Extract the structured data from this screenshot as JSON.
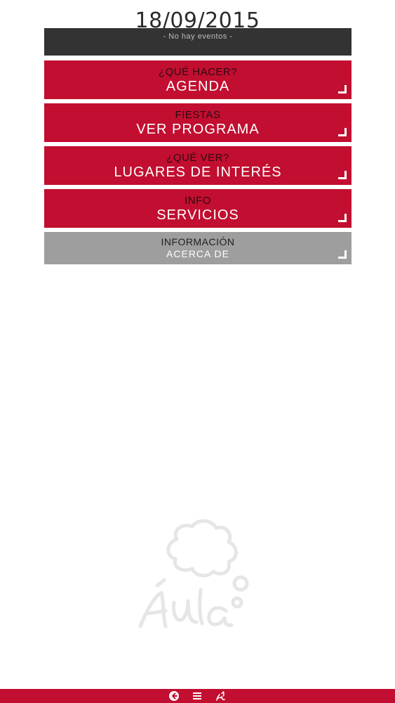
{
  "header": {
    "date": "18/09/2015"
  },
  "events": {
    "text": "- No hay eventos -"
  },
  "menu": [
    {
      "sub": "¿QUÉ HACER?",
      "main": "AGENDA"
    },
    {
      "sub": "FIESTAS",
      "main": "VER PROGRAMA"
    },
    {
      "sub": "¿QUÉ VER?",
      "main": "LUGARES DE INTERÉS"
    },
    {
      "sub": "INFO",
      "main": "SERVICIOS"
    },
    {
      "sub": "INFORMACIÓN",
      "main": "ACERCA DE"
    }
  ],
  "colors": {
    "accent": "#c20e30",
    "dark_bar": "#333333",
    "gray_button": "#9e9e9e"
  },
  "icons": [
    "back-icon",
    "menu-icon",
    "app-logo-icon"
  ]
}
